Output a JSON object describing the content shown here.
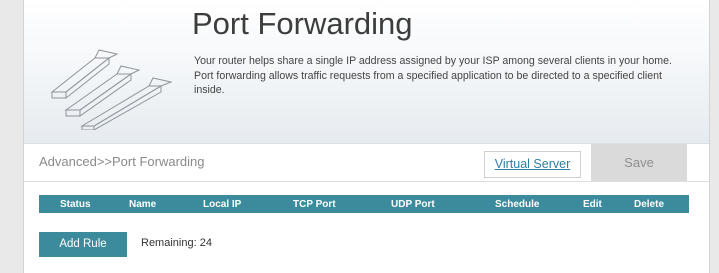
{
  "header": {
    "title": "Port Forwarding",
    "description": "Your router helps share a single IP address assigned by your ISP among several clients in your home. Port forwarding allows traffic requests from a specified application to be directed to a specified client inside.",
    "icon": "port-forwarding-arrows-icon"
  },
  "breadcrumb": "Advanced>>Port Forwarding",
  "toolbar": {
    "virtual_server_label": "Virtual Server",
    "save_label": "Save"
  },
  "table": {
    "columns": [
      "Status",
      "Name",
      "Local IP",
      "TCP Port",
      "UDP Port",
      "Schedule",
      "Edit",
      "Delete"
    ],
    "rows": []
  },
  "footer": {
    "add_rule_label": "Add Rule",
    "remaining_label": "Remaining: 24"
  },
  "colors": {
    "accent": "#3c8b9c",
    "link": "#2e7ea0",
    "save_disabled": "#dadada"
  }
}
